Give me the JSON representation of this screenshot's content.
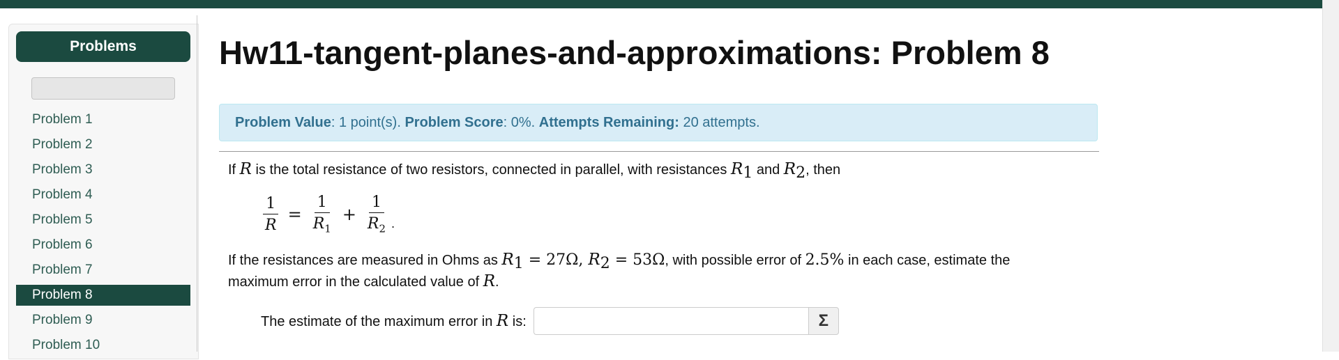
{
  "sidebar": {
    "header": "Problems",
    "search_placeholder": "",
    "items": [
      {
        "label": "Problem 1"
      },
      {
        "label": "Problem 2"
      },
      {
        "label": "Problem 3"
      },
      {
        "label": "Problem 4"
      },
      {
        "label": "Problem 5"
      },
      {
        "label": "Problem 6"
      },
      {
        "label": "Problem 7"
      },
      {
        "label": "Problem 8",
        "active": true
      },
      {
        "label": "Problem 9"
      },
      {
        "label": "Problem 10"
      }
    ]
  },
  "page": {
    "title": "Hw11-tangent-planes-and-approximations: Problem 8"
  },
  "info": {
    "value_label": "Problem Value",
    "value_text": ": 1 point(s). ",
    "score_label": "Problem Score",
    "score_text": ": 0%. ",
    "attempts_label": "Attempts Remaining:",
    "attempts_text": " 20 attempts."
  },
  "problem": {
    "line1_a": "If ",
    "var_R": "R",
    "line1_b": " is the total resistance of two resistors, connected in parallel, with resistances ",
    "var_R1": "R",
    "sub1": "1",
    "line1_and": " and ",
    "var_R2": "R",
    "sub2": "2",
    "line1_end": ", then",
    "formula": {
      "one": "1",
      "den_R": "R",
      "equals": "=",
      "plus": "+",
      "den_R1": "R",
      "den_sub1": "1",
      "den_R2": "R",
      "den_sub2": "2",
      "period": "."
    },
    "line2_a": "If the resistances are measured in Ohms as ",
    "r1_value": " = 27Ω, ",
    "r2_value": " = 53Ω",
    "line2_b": ", with possible error of ",
    "error_pct": "2.5%",
    "line2_c": " in each case, estimate the",
    "line3_a": "maximum error in the calculated value of ",
    "line3_end": "."
  },
  "answer": {
    "label_a": "The estimate of the maximum error in ",
    "label_var": "R",
    "label_b": " is:",
    "value": "",
    "sigma": "Σ"
  },
  "colors": {
    "brand": "#1b4a40",
    "info_bg": "#d9edf7",
    "info_text": "#31708f"
  }
}
